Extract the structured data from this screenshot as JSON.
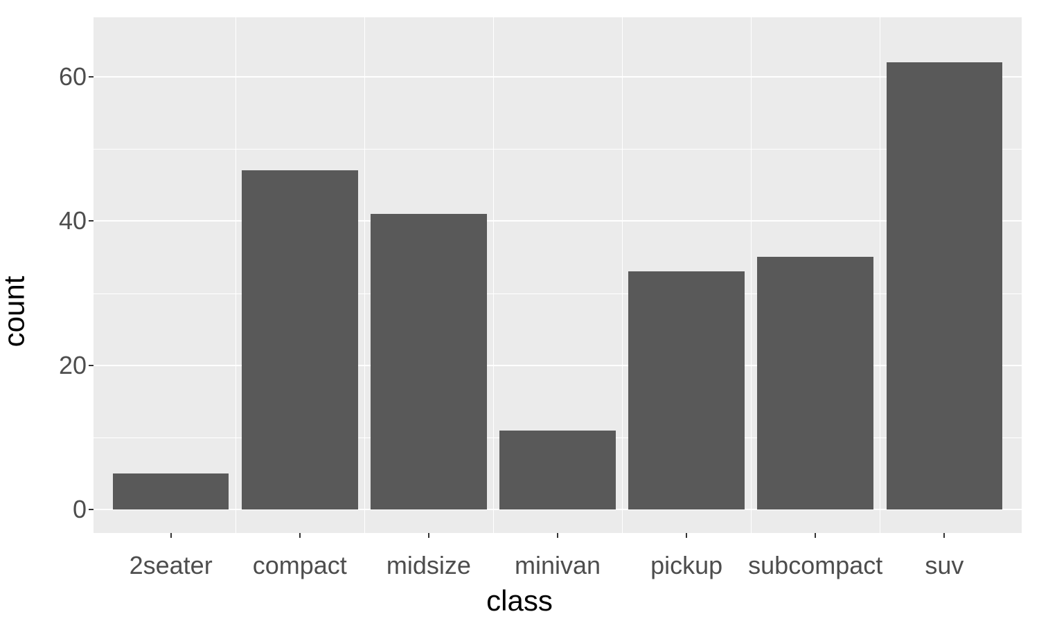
{
  "chart_data": {
    "type": "bar",
    "categories": [
      "2seater",
      "compact",
      "midsize",
      "minivan",
      "pickup",
      "subcompact",
      "suv"
    ],
    "values": [
      5,
      47,
      41,
      11,
      33,
      35,
      62
    ],
    "xlabel": "class",
    "ylabel": "count",
    "ylim": [
      0,
      65
    ],
    "y_ticks": [
      0,
      20,
      40,
      60
    ],
    "y_minor_ticks": [
      10,
      30,
      50
    ],
    "bar_fill": "#595959",
    "panel_bg": "#ebebeb",
    "grid_color": "#ffffff"
  }
}
